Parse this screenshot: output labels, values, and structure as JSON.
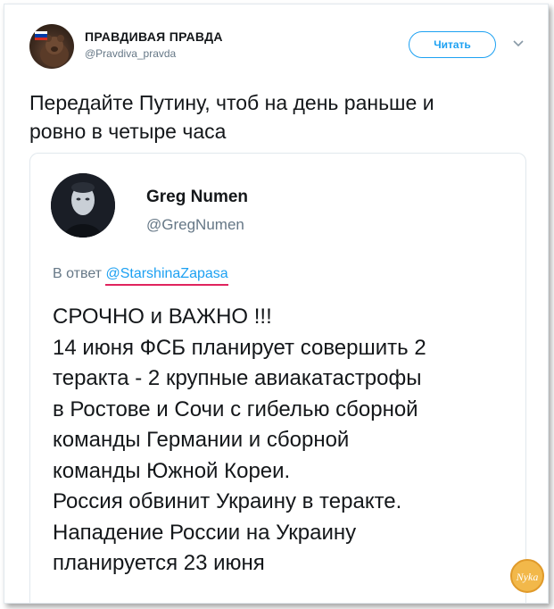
{
  "tweet": {
    "author_name": "ПРАВДИВАЯ ПРАВДА",
    "author_handle": "@Pravdiva_pravda",
    "follow_label": "Читать",
    "text_lines": [
      "Передайте Путину, чтоб на день раньше и",
      "ровно в четыре часа"
    ]
  },
  "quoted": {
    "author_name": "Greg Numen",
    "author_handle": "@GregNumen",
    "reply_prefix": "В ответ",
    "reply_mention": "@StarshinaZapasa",
    "text_lines": [
      "СРОЧНО и ВАЖНО !!!",
      "14 июня ФСБ планирует совершить 2",
      "теракта - 2 крупные авиакатастрофы",
      "в Ростове и Сочи с гибелью сборной",
      "команды Германии и сборной",
      "команды Южной Кореи.",
      "Россия обвинит Украину в теракте.",
      "Нападение России на Украину",
      "планируется 23 июня"
    ]
  },
  "watermark": {
    "text": "Nyka"
  },
  "colors": {
    "accent": "#1da1f2",
    "text": "#14171a",
    "muted": "#657786",
    "mention_underline": "#e0245e",
    "border": "#e1e8ed"
  },
  "icons": {
    "follow_menu": "chevron-down-icon",
    "author_flag": "russia-flag-icon"
  }
}
